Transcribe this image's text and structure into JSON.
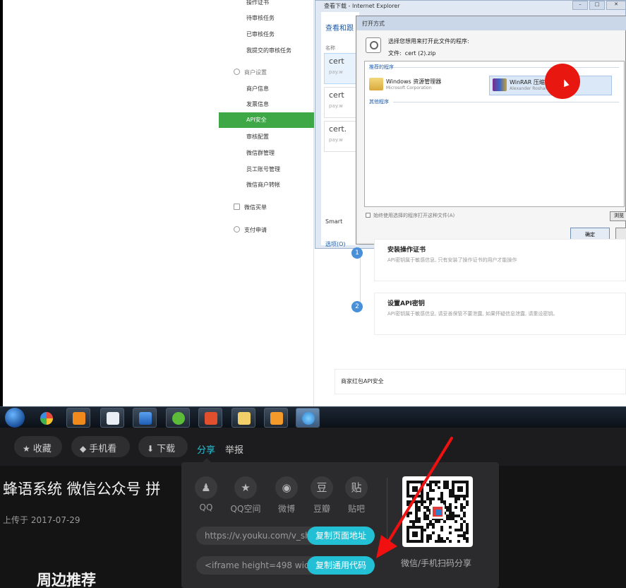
{
  "video_frame": {
    "menu": {
      "top_items": [
        "操作证书",
        "待审核任务",
        "已审核任务",
        "我提交的审核任务"
      ],
      "account_heading": "商户设置",
      "account_items": [
        "商户信息",
        "发票信息"
      ],
      "active_item": "API安全",
      "more_items": [
        "审核配置",
        "微信群管理",
        "员工账号管理",
        "微信商户转帐"
      ],
      "other_headings": [
        "微信买单",
        "支付申请"
      ]
    },
    "ie_window": {
      "title": "查看下载 - Internet Explorer",
      "inner_heading": "查看和跟",
      "column_label": "名称",
      "certs": [
        {
          "name": "cert",
          "sub": "pay.w"
        },
        {
          "name": "cert",
          "sub": "pay.w"
        },
        {
          "name": "cert.",
          "sub": "pay.w"
        }
      ],
      "smartscreen": "Smart",
      "options_link": "选项(O)"
    },
    "open_with": {
      "title": "打开方式",
      "prompt": "选择您想用来打开此文件的程序:",
      "file_label": "文件:",
      "file_name": "cert (2).zip",
      "recommended_group": "推荐的程序",
      "other_group": "其他程序",
      "programs": [
        {
          "name": "Windows 资源管理器",
          "corp": "Microsoft Corporation"
        },
        {
          "name": "WinRAR 压缩文件管理器",
          "corp": "Alexander Roshal"
        }
      ],
      "always_use": "始终使用选择的程序打开这种文件(A)",
      "browse": "浏览",
      "ok": "确定"
    },
    "steps": [
      {
        "num": "1",
        "title": "安装操作证书",
        "desc": "API密钥属于敏感信息, 只有安装了操作证书的用户才能操作"
      },
      {
        "num": "2",
        "title": "设置API密钥",
        "desc": "API密钥属于敏感信息, 请妥善保管不要泄露, 如果怀疑信息泄露, 请重设密钥。"
      }
    ],
    "section_title": "商家红包API安全",
    "taskbar_icons": [
      "start",
      "pinwheel",
      "store",
      "notepad",
      "network",
      "green",
      "slides",
      "folder",
      "mail",
      "ie"
    ],
    "colors": {
      "active_menu": "#3da845",
      "step_blue": "#4a90d9",
      "pointer_red": "#e8170f"
    }
  },
  "actions": {
    "favorite": {
      "icon": "star-icon",
      "label": "收藏"
    },
    "mobile": {
      "icon": "diamond-icon",
      "label": "手机看"
    },
    "download": {
      "icon": "download-icon",
      "label": "下载"
    },
    "share": "分享",
    "report": "举报"
  },
  "video": {
    "title": "蜂语系统 微信公众号 拼",
    "upload_date": "上传于 2017-07-29",
    "related_heading": "周边推荐"
  },
  "share_popup": {
    "targets": [
      {
        "icon": "qq-icon",
        "glyph": "♟",
        "label": "QQ"
      },
      {
        "icon": "qzone-icon",
        "glyph": "★",
        "label": "QQ空间"
      },
      {
        "icon": "weibo-icon",
        "glyph": "◉",
        "label": "微博"
      },
      {
        "icon": "douban-icon",
        "glyph": "豆",
        "label": "豆瓣"
      },
      {
        "icon": "tieba-icon",
        "glyph": "贴",
        "label": "贴吧"
      }
    ],
    "page_url": "https://v.youku.com/v_sho",
    "copy_page_url": "复制页面地址",
    "embed_code": "<iframe height=498 widt",
    "copy_embed": "复制通用代码",
    "qr_caption": "微信/手机扫码分享",
    "accent": "#23c0d5"
  },
  "annotation": {
    "arrow_color": "#f01010"
  }
}
